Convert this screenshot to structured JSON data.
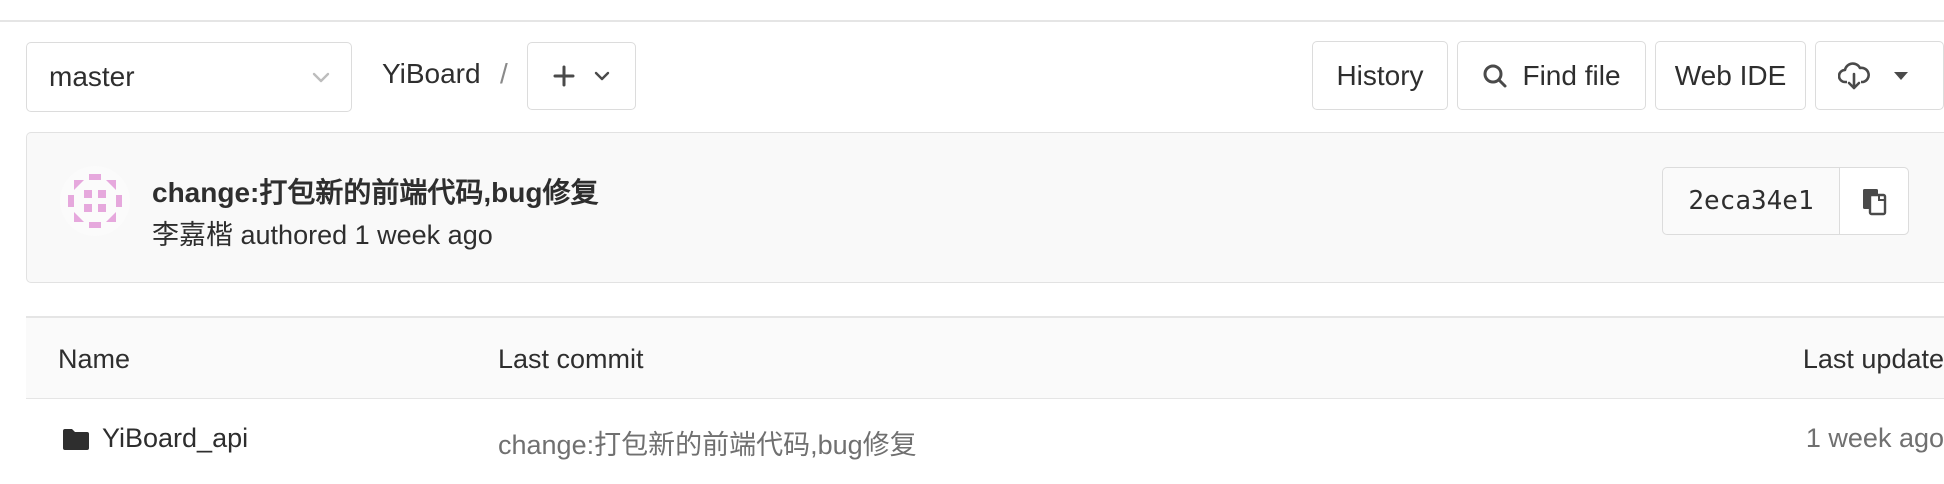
{
  "toolbar": {
    "branch": "master",
    "repo_name": "YiBoard",
    "separator": "/",
    "add_icon": "plus-icon",
    "history_label": "History",
    "find_file_label": "Find file",
    "web_ide_label": "Web IDE",
    "download_icon": "cloud-download-icon"
  },
  "commit": {
    "title": "change:打包新的前端代码,bug修复",
    "author": "李嘉楷",
    "authored_label": "authored",
    "time": "1 week ago",
    "sha": "2eca34e1",
    "copy_icon": "clipboard-icon",
    "avatar_color": "#e6a8dd"
  },
  "table": {
    "headers": {
      "name": "Name",
      "last_commit": "Last commit",
      "last_update": "Last update"
    },
    "rows": [
      {
        "icon": "folder-icon",
        "name": "YiBoard_api",
        "last_commit": "change:打包新的前端代码,bug修复",
        "last_update": "1 week ago"
      }
    ]
  }
}
